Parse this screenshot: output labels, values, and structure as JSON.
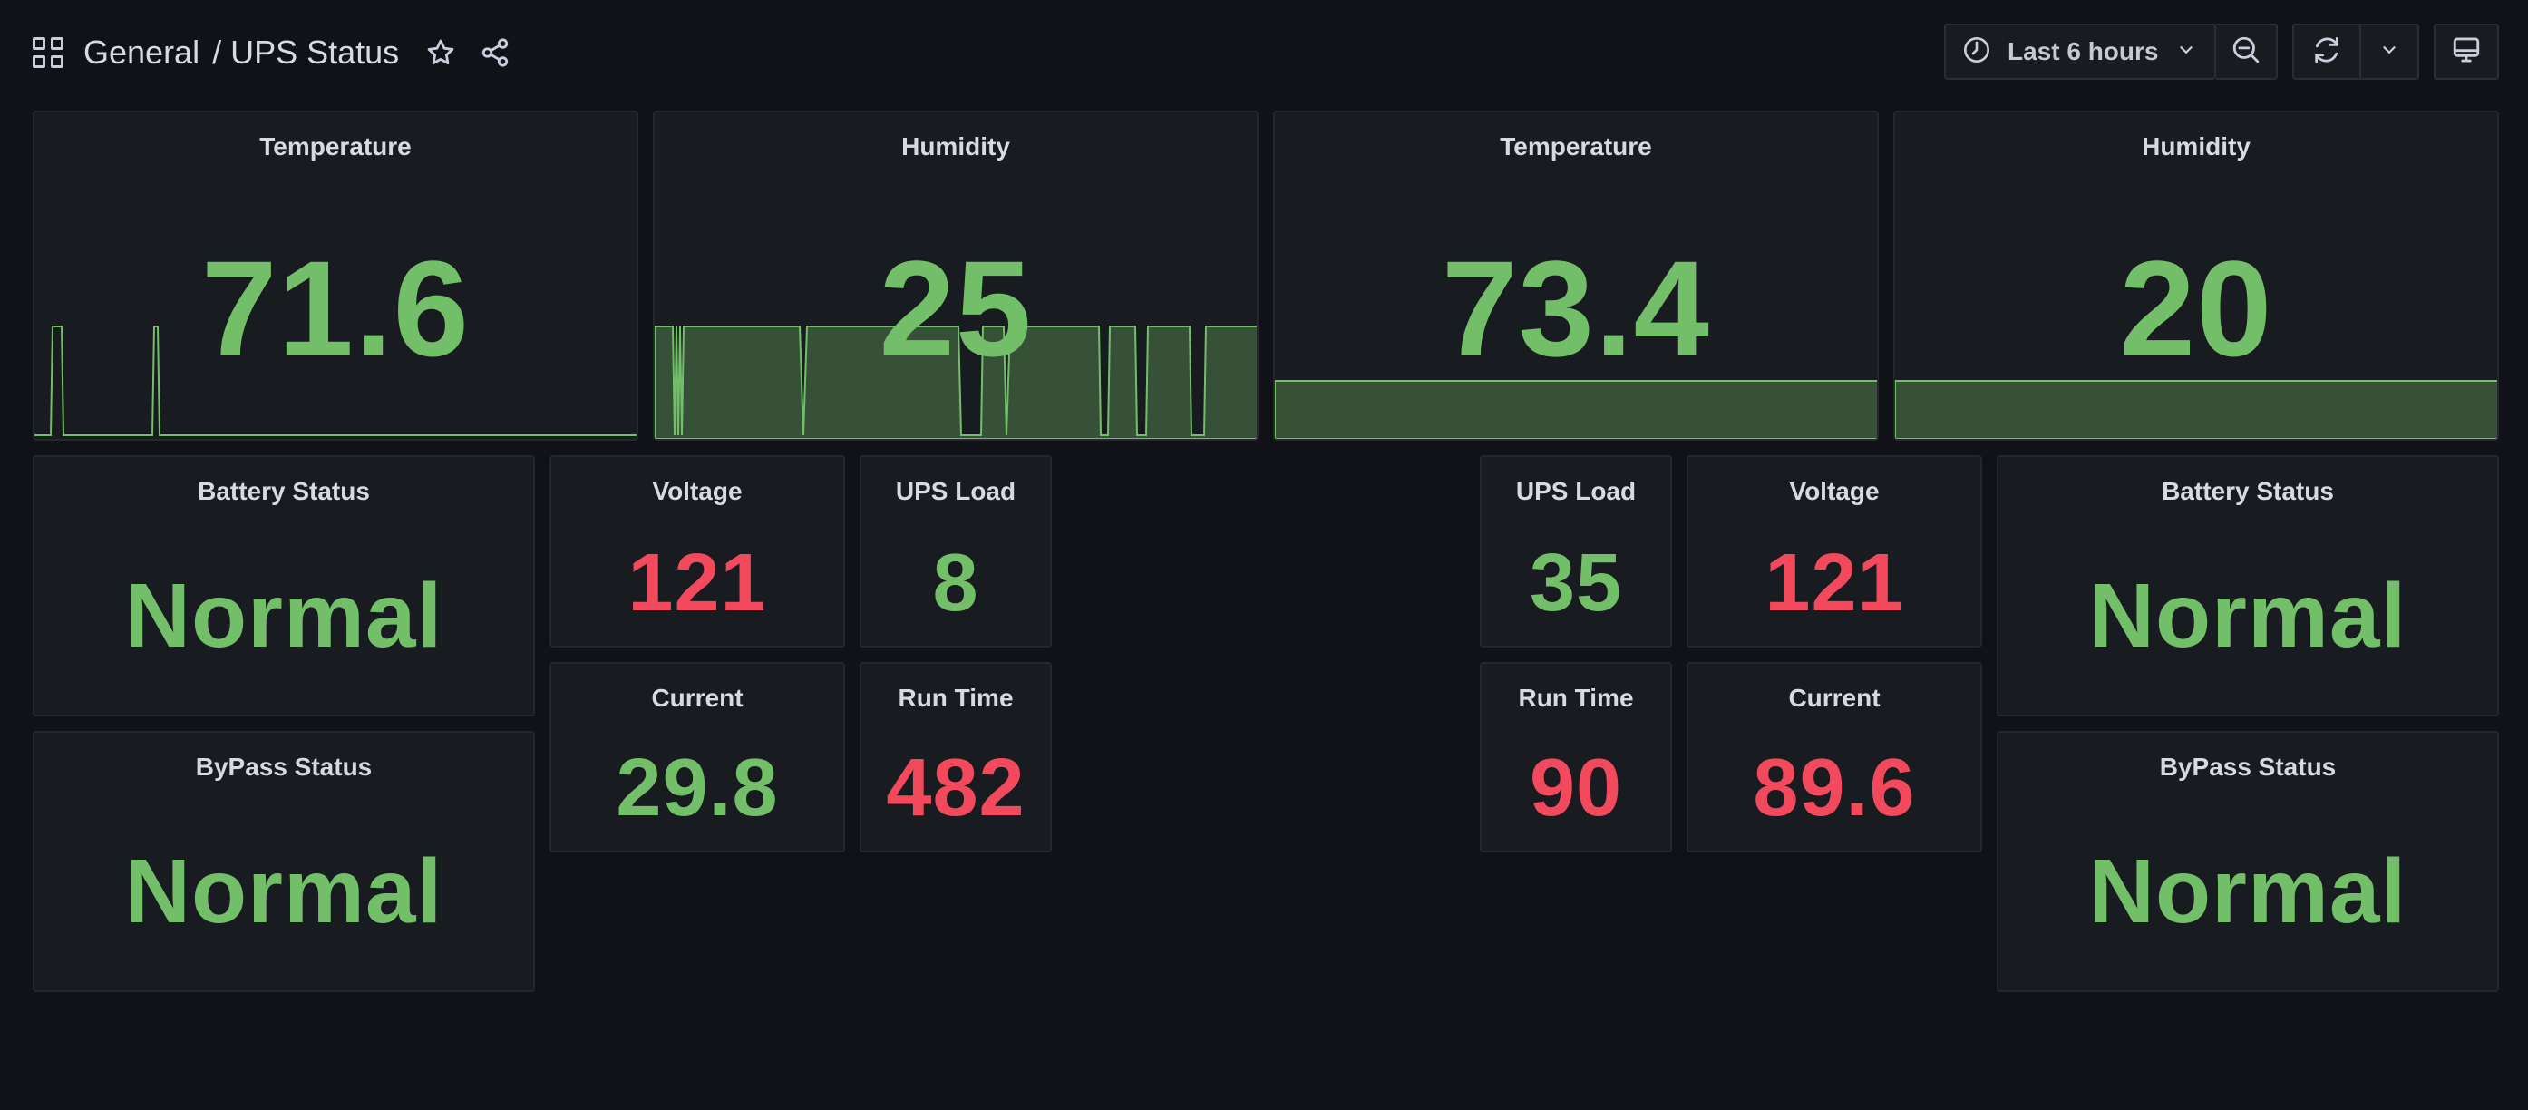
{
  "header": {
    "folder": "General",
    "separator": "/",
    "dashboard_title": "UPS Status",
    "icons": {
      "apps": "apps-grid-icon",
      "star": "star-icon",
      "share": "share-icon"
    }
  },
  "toolbar": {
    "time_range": "Last 6 hours",
    "icons": {
      "clock": "clock-icon",
      "zoom_out": "zoom-out-icon",
      "refresh": "refresh-icon",
      "caret": "chevron-down-icon",
      "tv": "tv-mode-icon"
    }
  },
  "colors": {
    "ok": "#73bf69",
    "alert": "#f2495c",
    "panel_bg": "#181b1f",
    "page_bg": "#111217"
  },
  "panels": {
    "temp_left": {
      "title": "Temperature",
      "value": "71.6"
    },
    "hum_left": {
      "title": "Humidity",
      "value": "25"
    },
    "temp_right": {
      "title": "Temperature",
      "value": "73.4"
    },
    "hum_right": {
      "title": "Humidity",
      "value": "20"
    },
    "battery_left": {
      "title": "Battery Status",
      "value": "Normal"
    },
    "bypass_left": {
      "title": "ByPass Status",
      "value": "Normal"
    },
    "voltage_left": {
      "title": "Voltage",
      "value": "121"
    },
    "upsload_left": {
      "title": "UPS Load",
      "value": "8"
    },
    "current_left": {
      "title": "Current",
      "value": "29.8"
    },
    "runtime_left": {
      "title": "Run Time",
      "value": "482"
    },
    "upsload_right": {
      "title": "UPS Load",
      "value": "35"
    },
    "voltage_right": {
      "title": "Voltage",
      "value": "121"
    },
    "runtime_right": {
      "title": "Run Time",
      "value": "90"
    },
    "current_right": {
      "title": "Current",
      "value": "89.6"
    },
    "battery_right": {
      "title": "Battery Status",
      "value": "Normal"
    },
    "bypass_right": {
      "title": "ByPass Status",
      "value": "Normal"
    }
  }
}
